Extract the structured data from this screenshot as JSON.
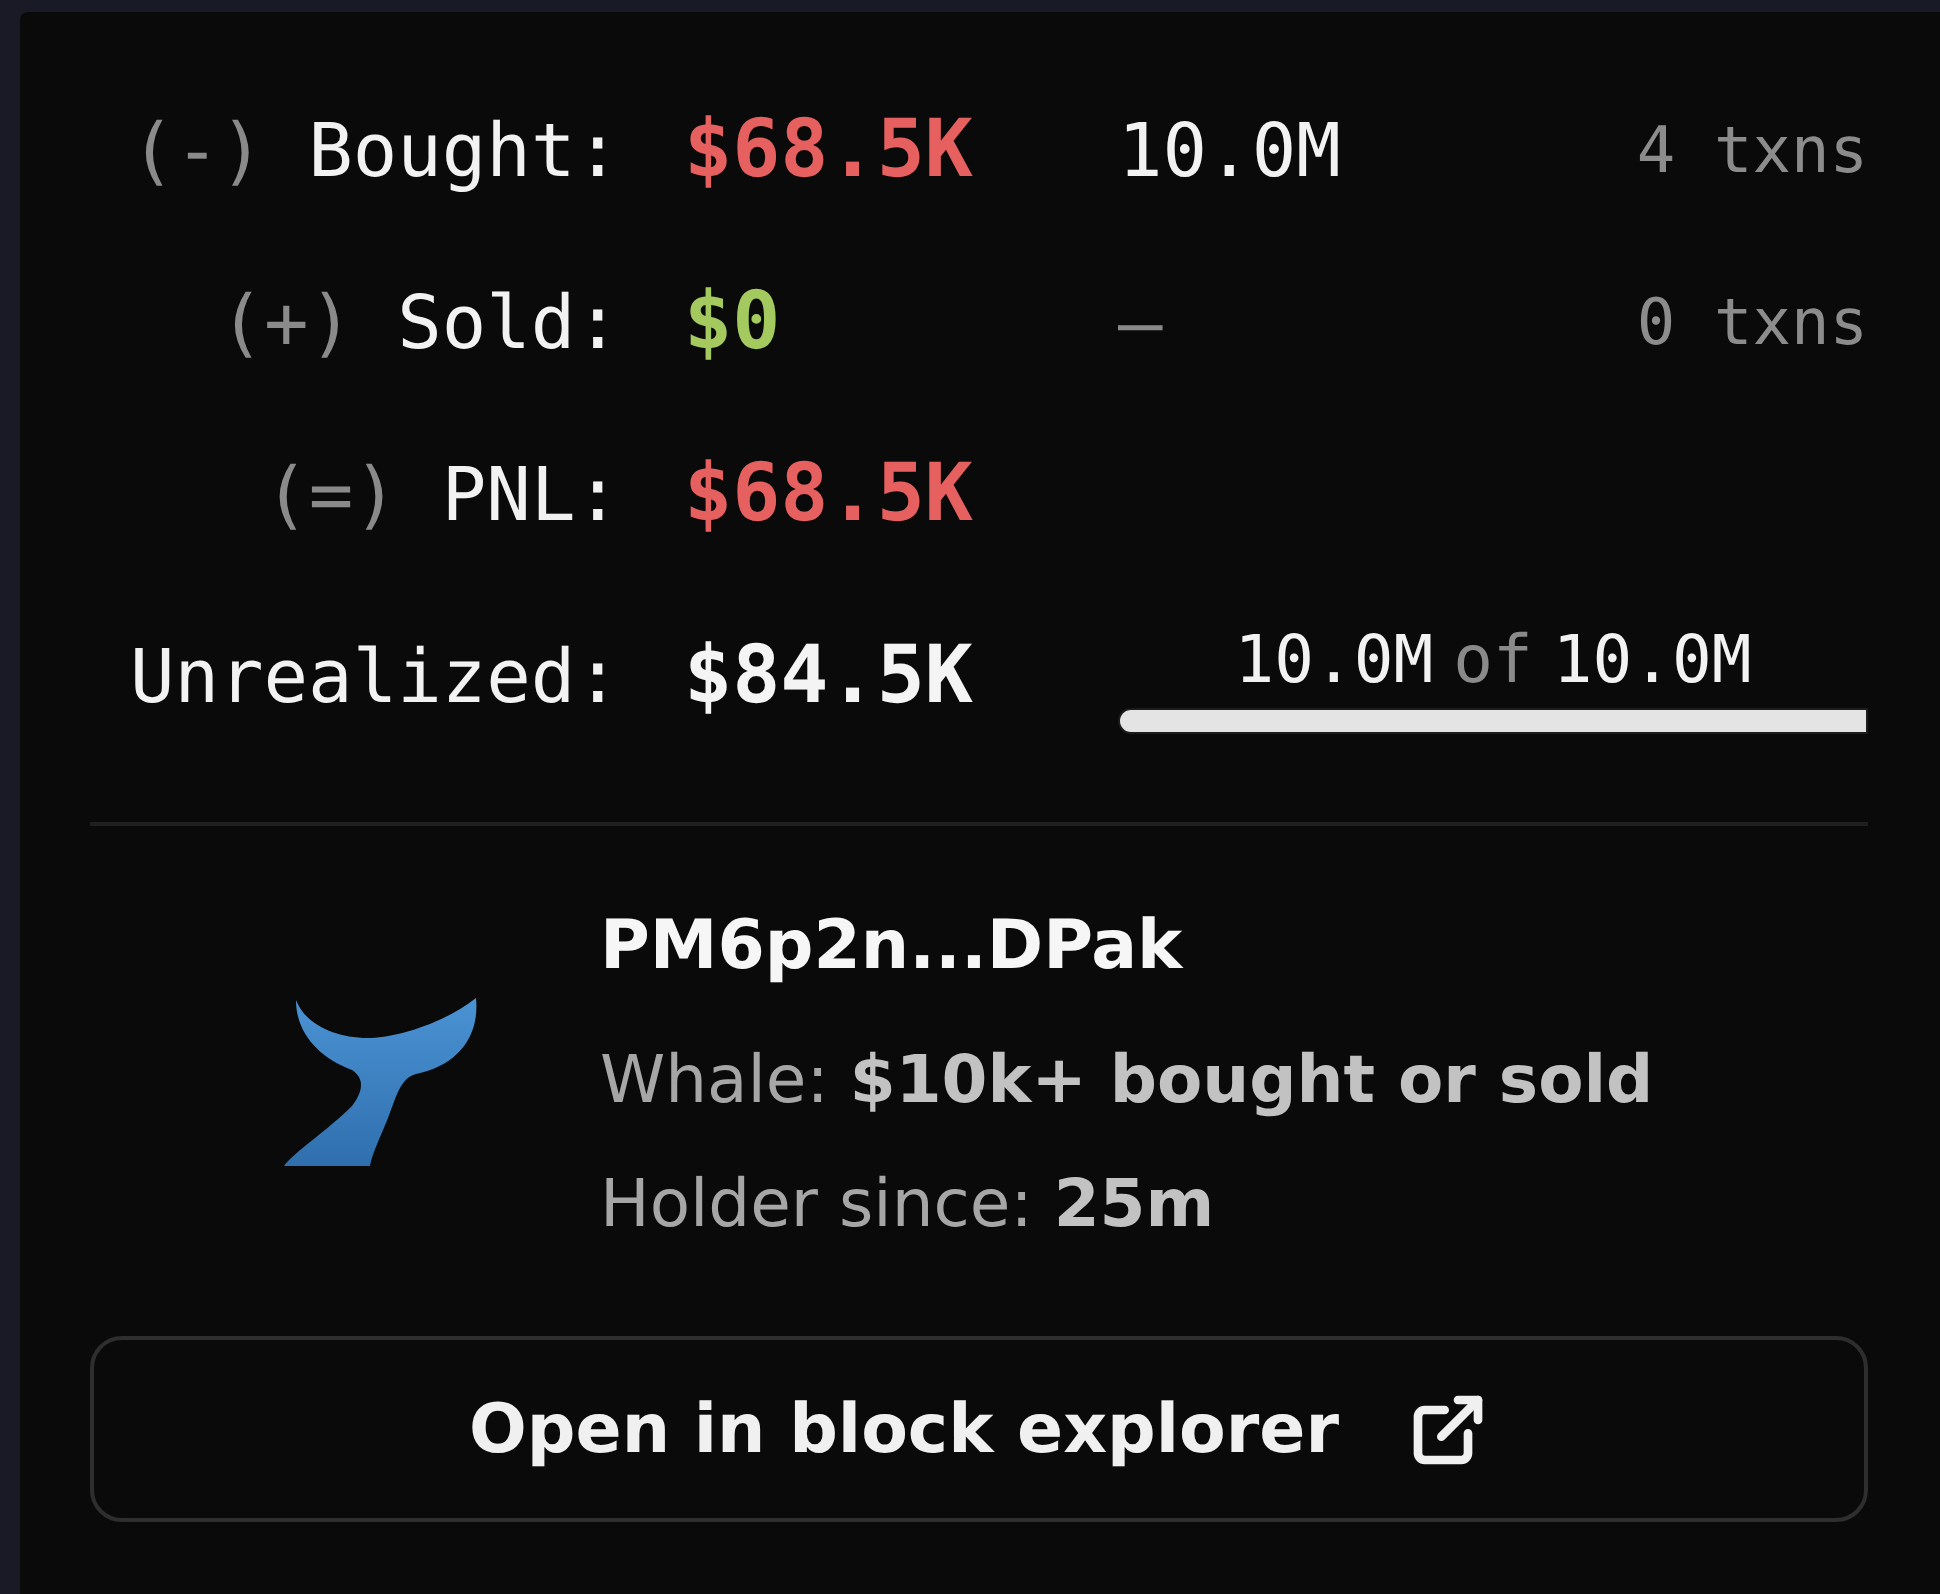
{
  "stats": [
    {
      "sign": "(-)",
      "label": "Bought:",
      "value": "$68.5K",
      "color": "#e5605e",
      "amount": "10.0M",
      "dimmed": false,
      "txns": "4 txns"
    },
    {
      "sign": "(+)",
      "label": "Sold:",
      "value": "$0",
      "color": "#a4c95f",
      "amount": "–",
      "dimmed": true,
      "txns": "0 txns"
    },
    {
      "sign": "(=)",
      "label": "PNL:",
      "value": "$68.5K",
      "color": "#e5605e"
    }
  ],
  "unrealized": {
    "label": "Unrealized:",
    "value": "$84.5K",
    "held": "10.0M",
    "joiner": "of",
    "total": "10.0M",
    "level": 1
  },
  "holder": {
    "address": "PM6p2n...DPak",
    "lines": [
      "Whale: **$10k+ bought or sold**",
      "Holder since: **25m**"
    ]
  },
  "button": {
    "label": "Open in block explorer"
  }
}
